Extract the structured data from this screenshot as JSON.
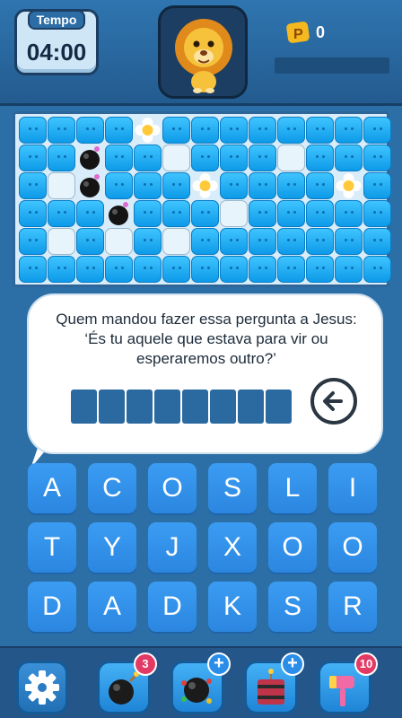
{
  "header": {
    "timer_label": "Tempo",
    "timer_value": "04:00",
    "coins": "0",
    "progress": 0
  },
  "board": {
    "rows": [
      [
        "t",
        "t",
        "t",
        "t",
        "f",
        "t",
        "t",
        "t",
        "t",
        "t",
        "t",
        "t",
        "t"
      ],
      [
        "t",
        "t",
        "b",
        "t",
        "t",
        "i",
        "t",
        "t",
        "t",
        "i",
        "t",
        "t",
        "t"
      ],
      [
        "t",
        "i",
        "b",
        "t",
        "t",
        "t",
        "f",
        "t",
        "t",
        "t",
        "t",
        "f",
        "t"
      ],
      [
        "t",
        "t",
        "t",
        "b",
        "t",
        "t",
        "t",
        "i",
        "t",
        "t",
        "t",
        "t",
        "t"
      ],
      [
        "t",
        "i",
        "t",
        "i",
        "t",
        "i",
        "t",
        "t",
        "t",
        "t",
        "t",
        "t",
        "t"
      ],
      [
        "t",
        "t",
        "t",
        "t",
        "t",
        "t",
        "t",
        "t",
        "t",
        "t",
        "t",
        "t",
        "t"
      ]
    ]
  },
  "question": {
    "text": "Quem mandou fazer essa pergunta a  Jesus: ‘És tu aquele que estava para vir ou esperaremos outro?’",
    "answer_length": 8
  },
  "keyboard": {
    "keys": [
      "A",
      "C",
      "O",
      "S",
      "L",
      "I",
      "T",
      "Y",
      "J",
      "X",
      "O",
      "O",
      "D",
      "A",
      "D",
      "K",
      "S",
      "R"
    ]
  },
  "toolbar": {
    "tools": [
      {
        "name": "bomb",
        "badge": "3"
      },
      {
        "name": "multi-bomb",
        "badge": "+"
      },
      {
        "name": "dynamite",
        "badge": "+"
      },
      {
        "name": "hammer",
        "badge": "10"
      }
    ]
  },
  "colors": {
    "background": "#2c6fa6",
    "tile": "#1aa6f0",
    "key": "#3193ea",
    "badge_count": "#e23a64",
    "badge_plus": "#2a8ee8"
  }
}
